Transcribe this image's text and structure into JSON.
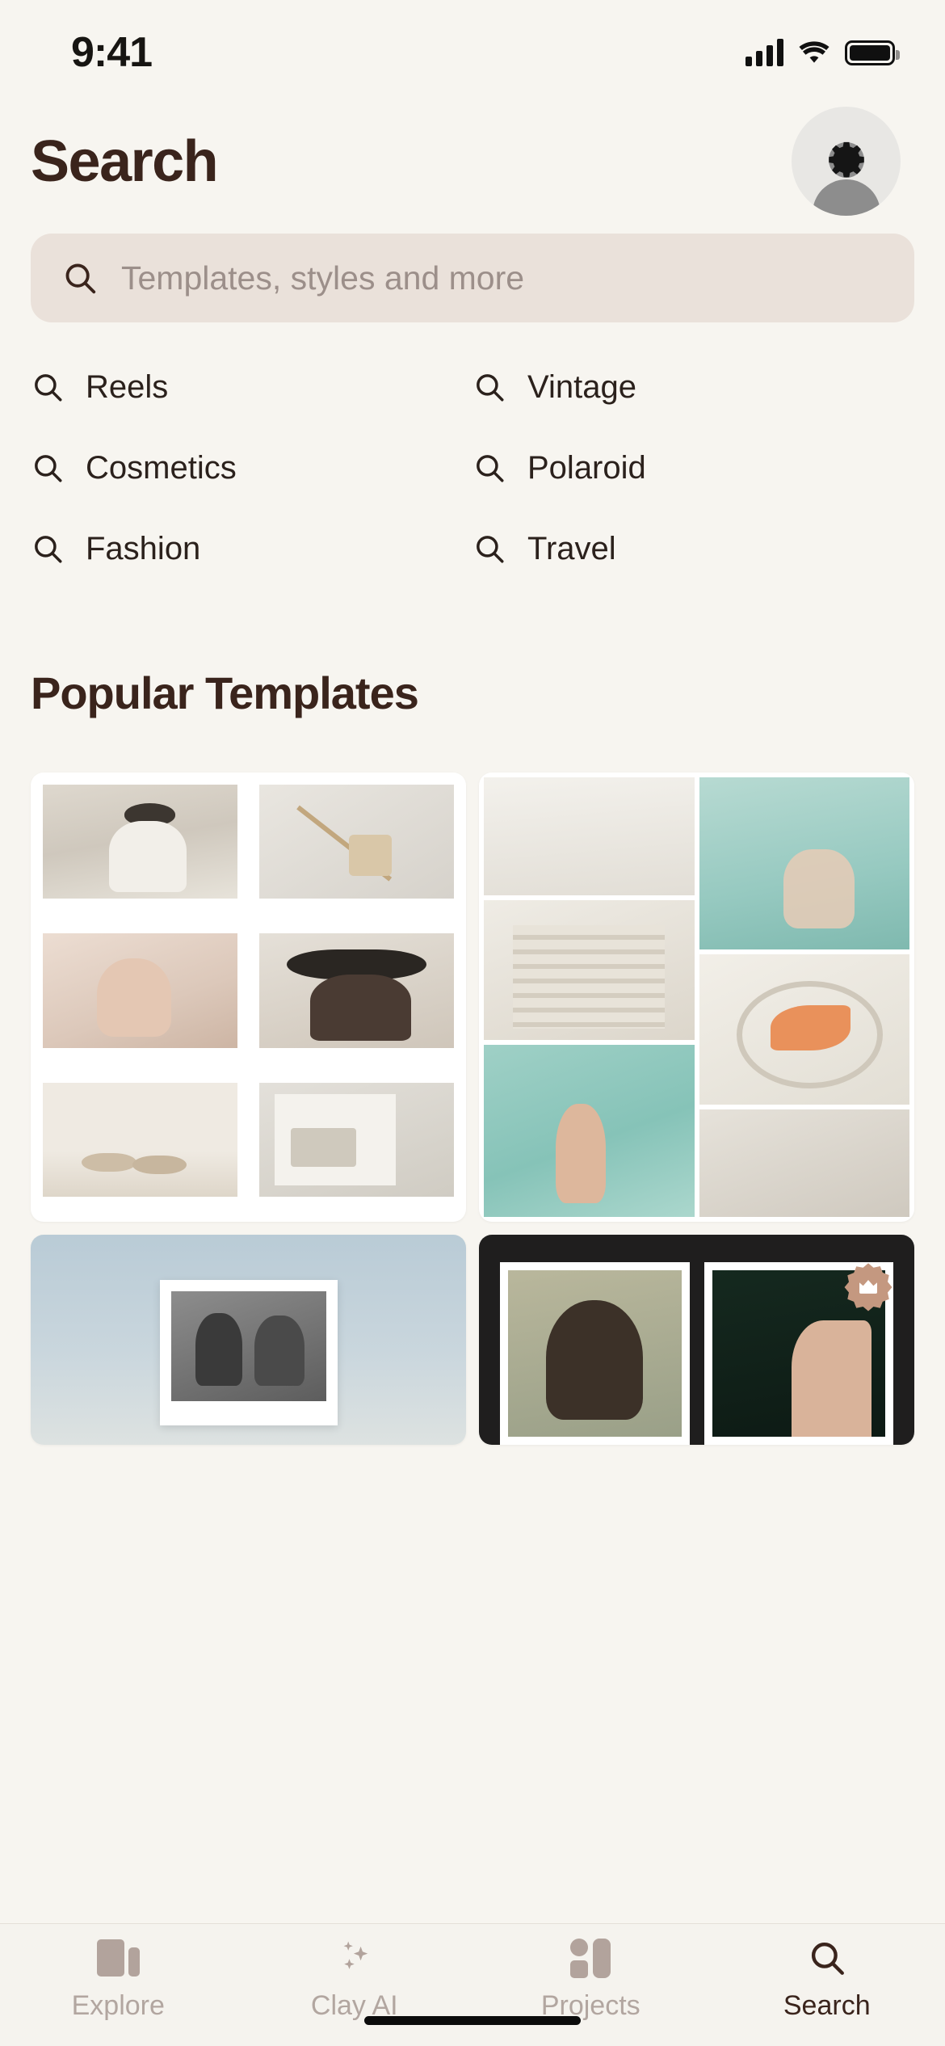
{
  "status_bar": {
    "time": "9:41",
    "cellular_icon": "signal-bars-icon",
    "wifi_icon": "wifi-icon",
    "battery_icon": "battery-icon"
  },
  "header": {
    "title": "Search",
    "avatar_icon": "profile-avatar",
    "settings_icon": "gear-icon"
  },
  "search": {
    "icon": "search-icon",
    "value": "",
    "placeholder": "Templates, styles and more"
  },
  "suggestions": [
    {
      "label": "Reels",
      "icon": "search-icon"
    },
    {
      "label": "Vintage",
      "icon": "search-icon"
    },
    {
      "label": "Cosmetics",
      "icon": "search-icon"
    },
    {
      "label": "Polaroid",
      "icon": "search-icon"
    },
    {
      "label": "Fashion",
      "icon": "search-icon"
    },
    {
      "label": "Travel",
      "icon": "search-icon"
    }
  ],
  "popular": {
    "title": "Popular Templates",
    "cards": [
      {
        "name": "polaroid-collage-template",
        "premium": false
      },
      {
        "name": "film-strip-collage-template",
        "premium": false
      },
      {
        "name": "sky-photo-frame-template",
        "premium": false
      },
      {
        "name": "dark-duo-frame-template",
        "premium": true,
        "badge_icon": "crown-badge-icon"
      }
    ]
  },
  "tabbar": {
    "tabs": [
      {
        "label": "Explore",
        "icon": "cards-icon",
        "active": false
      },
      {
        "label": "Clay AI",
        "icon": "sparkles-icon",
        "active": false
      },
      {
        "label": "Projects",
        "icon": "layout-icon",
        "active": false
      },
      {
        "label": "Search",
        "icon": "search-icon",
        "active": true
      }
    ]
  },
  "colors": {
    "background": "#f7f5f0",
    "accent_text": "#3a241c",
    "search_field": "#eae1da",
    "muted": "#b2a6a0",
    "badge": "#c49880"
  }
}
